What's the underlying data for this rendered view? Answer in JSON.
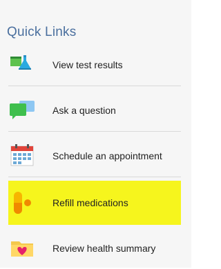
{
  "panel": {
    "title": "Quick Links",
    "links": [
      {
        "label": "View test results",
        "icon": "test-tubes-icon"
      },
      {
        "label": "Ask a question",
        "icon": "chat-bubbles-icon"
      },
      {
        "label": "Schedule an appointment",
        "icon": "calendar-icon"
      },
      {
        "label": "Refill medications",
        "icon": "pill-icon",
        "highlighted": true
      },
      {
        "label": "Review health summary",
        "icon": "heart-folder-icon"
      }
    ]
  },
  "colors": {
    "title": "#4a6f9e",
    "highlight": "#f6f51d",
    "background": "#f6f6f6"
  }
}
